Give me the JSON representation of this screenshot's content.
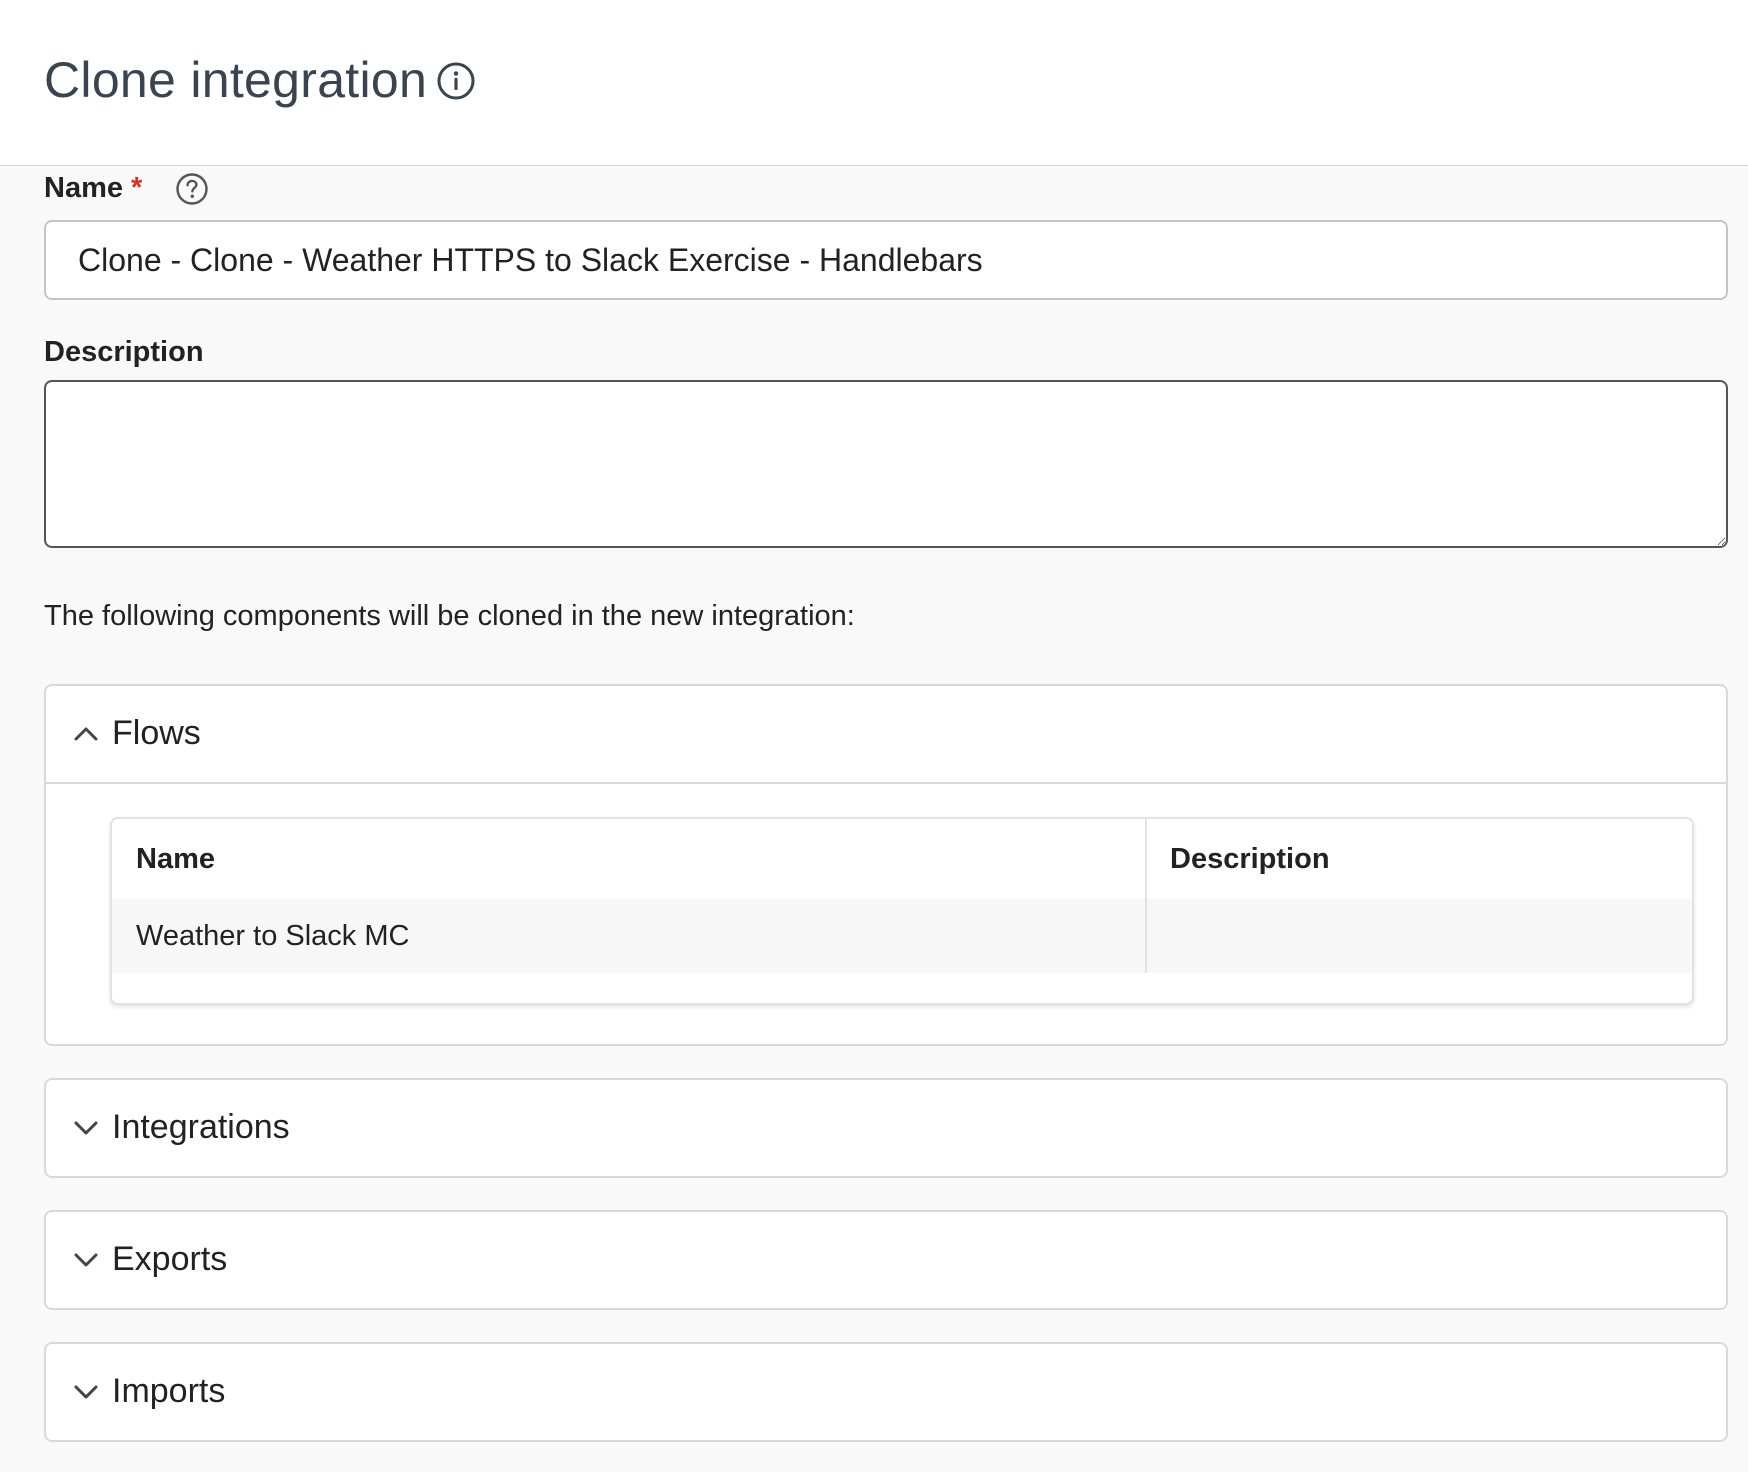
{
  "header": {
    "title": "Clone integration",
    "title_icon": "info-icon"
  },
  "form": {
    "name": {
      "label": "Name",
      "required_marker": "*",
      "help_icon": "question-circle-icon",
      "value": "Clone - Clone - Weather HTTPS to Slack Exercise - Handlebars"
    },
    "description": {
      "label": "Description",
      "value": ""
    },
    "intro_text": "The following components will be cloned in the new integration:"
  },
  "panels": [
    {
      "title": "Flows",
      "expanded": true,
      "chevron_icon": "chevron-up-icon",
      "table": {
        "columns": [
          "Name",
          "Description"
        ],
        "rows": [
          [
            "Weather to Slack MC",
            ""
          ]
        ]
      }
    },
    {
      "title": "Integrations",
      "expanded": false,
      "chevron_icon": "chevron-down-icon"
    },
    {
      "title": "Exports",
      "expanded": false,
      "chevron_icon": "chevron-down-icon"
    },
    {
      "title": "Imports",
      "expanded": false,
      "chevron_icon": "chevron-down-icon"
    }
  ],
  "colors": {
    "required": "#d93025",
    "title": "#3a4350",
    "border": "#d9d9d9"
  }
}
